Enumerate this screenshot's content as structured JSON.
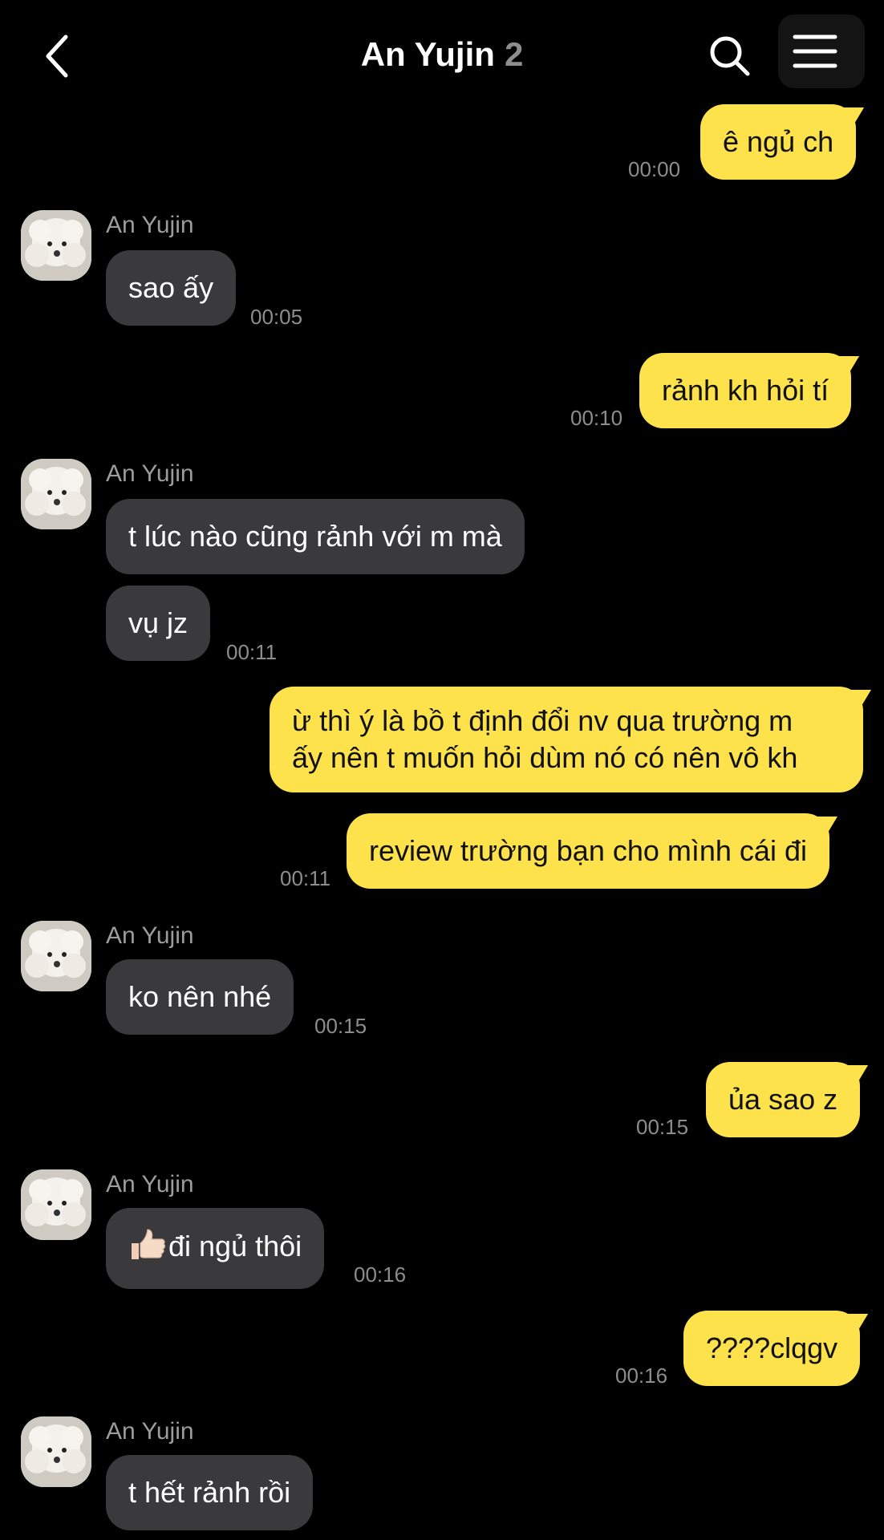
{
  "header": {
    "title": "An Yujin",
    "member_count": "2",
    "back_icon": "chevron-left-icon",
    "search_icon": "search-icon",
    "menu_icon": "hamburger-menu-icon"
  },
  "contact": {
    "name": "An Yujin"
  },
  "messages": [
    {
      "text": "ê ngủ ch",
      "time": "00:00"
    },
    {
      "text": "sao ấy",
      "time": "00:05"
    },
    {
      "text": "rảnh kh hỏi tí",
      "time": "00:10"
    },
    {
      "text": "t lúc nào cũng rảnh với m mà"
    },
    {
      "text": "vụ jz",
      "time": "00:11"
    },
    {
      "line1": "ừ thì ý là bồ t định đổi nv qua trường m",
      "line2": "ấy nên t muốn hỏi dùm nó có nên vô kh"
    },
    {
      "text": "review trường bạn cho mình cái đi",
      "time": "00:11"
    },
    {
      "text": "ko nên nhé",
      "time": "00:15"
    },
    {
      "text": "ủa sao z",
      "time": "00:15"
    },
    {
      "text": "đi ngủ thôi",
      "time": "00:16"
    },
    {
      "text": "????clqgv",
      "time": "00:16"
    },
    {
      "text": "t hết rảnh rồi"
    }
  ],
  "colors": {
    "background": "#000000",
    "outgoing_bubble": "#fde24b",
    "incoming_bubble": "#3a3a3c"
  }
}
